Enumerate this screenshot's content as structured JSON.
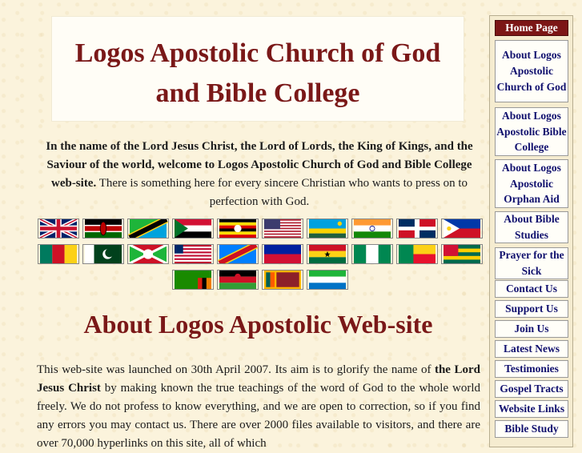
{
  "title_line1": "Logos Apostolic Church of God",
  "title_line2": "and Bible College",
  "intro": {
    "bold_part": "In the name of the Lord Jesus Christ, the Lord of Lords, the King of Kings, and the Saviour of the world, welcome to Logos Apostolic Church of God and Bible College web-site.",
    "normal_part": " There is something here for every sincere Christian who wants to press on to perfection with God."
  },
  "flags": [
    "united-kingdom",
    "kenya",
    "tanzania",
    "sudan",
    "uganda",
    "united-states",
    "rwanda",
    "india",
    "dominican-republic",
    "philippines",
    "cameroon",
    "pakistan",
    "burundi",
    "liberia",
    "congo-dr",
    "haiti",
    "ghana",
    "nigeria",
    "benin",
    "togo",
    "zambia",
    "malawi",
    "sri-lanka",
    "sierra-leone"
  ],
  "section_heading": "About Logos Apostolic Web-site",
  "body": {
    "p1_a": "This web-site was launched on 30th April 2007. Its aim is to glorify the name of ",
    "p1_b": "the Lord Jesus Christ",
    "p1_c": " by making known the true teachings of the word of God to the whole world freely. We do not profess to know everything, and we are open to correction, so if you find any errors you may contact us. There are over 2000 files available to visitors, and there are over 70,000 hyperlinks on this site, all of which"
  },
  "nav": [
    {
      "label": "Home Page"
    },
    {
      "label": "About Logos Apostolic Church of God"
    },
    {
      "label": "About Logos Apostolic Bible College"
    },
    {
      "label": "About Logos Apostolic Orphan Aid"
    },
    {
      "label": "About Bible Studies"
    },
    {
      "label": "Prayer for the Sick"
    },
    {
      "label": "Contact Us"
    },
    {
      "label": "Support Us"
    },
    {
      "label": "Join Us"
    },
    {
      "label": "Latest News"
    },
    {
      "label": "Testimonies"
    },
    {
      "label": "Gospel Tracts"
    },
    {
      "label": "Website Links"
    },
    {
      "label": "Bible Study"
    }
  ],
  "colors": {
    "title": "#7a1818",
    "nav_text": "#10106e",
    "home_bg": "#7c1616",
    "page_bg": "#fbf3dc"
  }
}
